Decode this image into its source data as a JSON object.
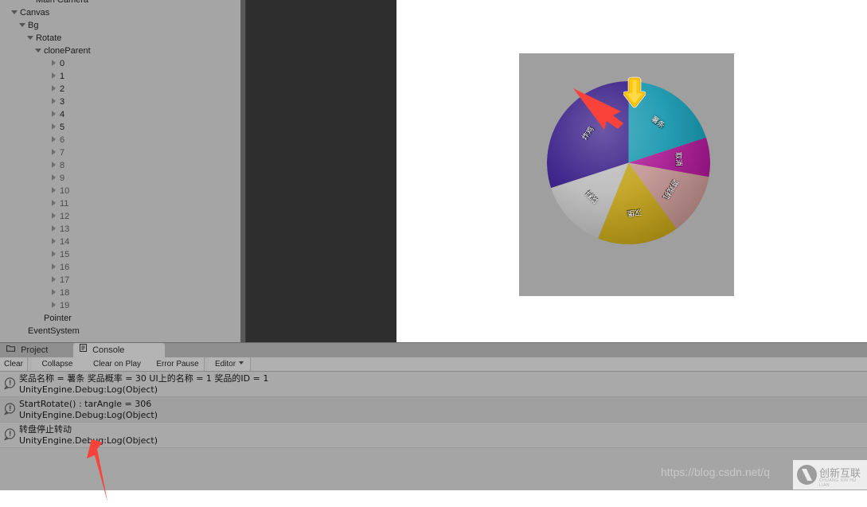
{
  "hierarchy": {
    "rows": [
      {
        "label": "Main Camera",
        "indent": 3,
        "twisty": "none",
        "dim": false,
        "clipped": true
      },
      {
        "label": "Canvas",
        "indent": 1,
        "twisty": "down",
        "dim": false
      },
      {
        "label": "Bg",
        "indent": 2,
        "twisty": "down",
        "dim": false
      },
      {
        "label": "Rotate",
        "indent": 3,
        "twisty": "down",
        "dim": false
      },
      {
        "label": "cloneParent",
        "indent": 4,
        "twisty": "down",
        "dim": false
      },
      {
        "label": "0",
        "indent": 6,
        "twisty": "right",
        "dim": false
      },
      {
        "label": "1",
        "indent": 6,
        "twisty": "right",
        "dim": false
      },
      {
        "label": "2",
        "indent": 6,
        "twisty": "right",
        "dim": false
      },
      {
        "label": "3",
        "indent": 6,
        "twisty": "right",
        "dim": false
      },
      {
        "label": "4",
        "indent": 6,
        "twisty": "right",
        "dim": false
      },
      {
        "label": "5",
        "indent": 6,
        "twisty": "right",
        "dim": false
      },
      {
        "label": "6",
        "indent": 6,
        "twisty": "right",
        "dim": true
      },
      {
        "label": "7",
        "indent": 6,
        "twisty": "right",
        "dim": true
      },
      {
        "label": "8",
        "indent": 6,
        "twisty": "right",
        "dim": true
      },
      {
        "label": "9",
        "indent": 6,
        "twisty": "right",
        "dim": true
      },
      {
        "label": "10",
        "indent": 6,
        "twisty": "right",
        "dim": true
      },
      {
        "label": "11",
        "indent": 6,
        "twisty": "right",
        "dim": true
      },
      {
        "label": "12",
        "indent": 6,
        "twisty": "right",
        "dim": true
      },
      {
        "label": "13",
        "indent": 6,
        "twisty": "right",
        "dim": true
      },
      {
        "label": "14",
        "indent": 6,
        "twisty": "right",
        "dim": true
      },
      {
        "label": "15",
        "indent": 6,
        "twisty": "right",
        "dim": true
      },
      {
        "label": "16",
        "indent": 6,
        "twisty": "right",
        "dim": true
      },
      {
        "label": "17",
        "indent": 6,
        "twisty": "right",
        "dim": true
      },
      {
        "label": "18",
        "indent": 6,
        "twisty": "right",
        "dim": true
      },
      {
        "label": "19",
        "indent": 6,
        "twisty": "right",
        "dim": true
      },
      {
        "label": "Pointer",
        "indent": 4,
        "twisty": "none",
        "dim": false
      },
      {
        "label": "EventSystem",
        "indent": 2,
        "twisty": "none",
        "dim": false
      }
    ]
  },
  "game_view": {
    "wheel": {
      "pointer_icon": "down-arrow-pointer",
      "segments": [
        {
          "label": "薯条",
          "color": "#0e93ab",
          "start_deg": -90,
          "sweep_deg": 72
        },
        {
          "label": "取消",
          "color": "#a6128f",
          "start_deg": -18,
          "sweep_deg": 28
        },
        {
          "label": "游戏机",
          "color": "#c0918e",
          "start_deg": 10,
          "sweep_deg": 44
        },
        {
          "label": "汉堡",
          "color": "#bf9f14",
          "start_deg": 54,
          "sweep_deg": 58
        },
        {
          "label": "饮料",
          "color": "#b8b8b8",
          "start_deg": 112,
          "sweep_deg": 50
        },
        {
          "label": "炸鸡",
          "color": "#2c1080",
          "start_deg": 162,
          "sweep_deg": 108
        }
      ]
    }
  },
  "console": {
    "tabs": [
      {
        "label": "Project",
        "icon": "folder-icon",
        "active": false
      },
      {
        "label": "Console",
        "icon": "console-icon",
        "active": true
      }
    ],
    "toolbar": [
      {
        "label": "Clear",
        "type": "button"
      },
      {
        "label": "Collapse",
        "type": "toggle"
      },
      {
        "label": "Clear on Play",
        "type": "toggle"
      },
      {
        "label": "Error Pause",
        "type": "toggle"
      },
      {
        "label": "Editor",
        "type": "dropdown"
      }
    ],
    "messages": [
      {
        "icon": "info-icon",
        "line1": "奖品名称 = 薯条  奖品概率 = 30  UI上的名称 = 1  奖品的ID = 1",
        "line2": "UnityEngine.Debug:Log(Object)"
      },
      {
        "icon": "info-icon",
        "line1": "StartRotate() : tarAngle = 306",
        "line2": "UnityEngine.Debug:Log(Object)"
      },
      {
        "icon": "info-icon",
        "line1": "转盘停止转动",
        "line2": "UnityEngine.Debug:Log(Object)"
      }
    ]
  },
  "watermark": {
    "url": "https://blog.csdn.net/q",
    "logo_cn": "创新互联",
    "logo_en": "CHUANG XIN HU LIAN"
  },
  "colors": {
    "hierarchy_bg": "#a5a5a5",
    "dark_panel": "#2e2e2e",
    "game_bg": "#9f9f9f",
    "annotation_red": "#f9423a",
    "pointer_yellow": "#ffc808"
  }
}
